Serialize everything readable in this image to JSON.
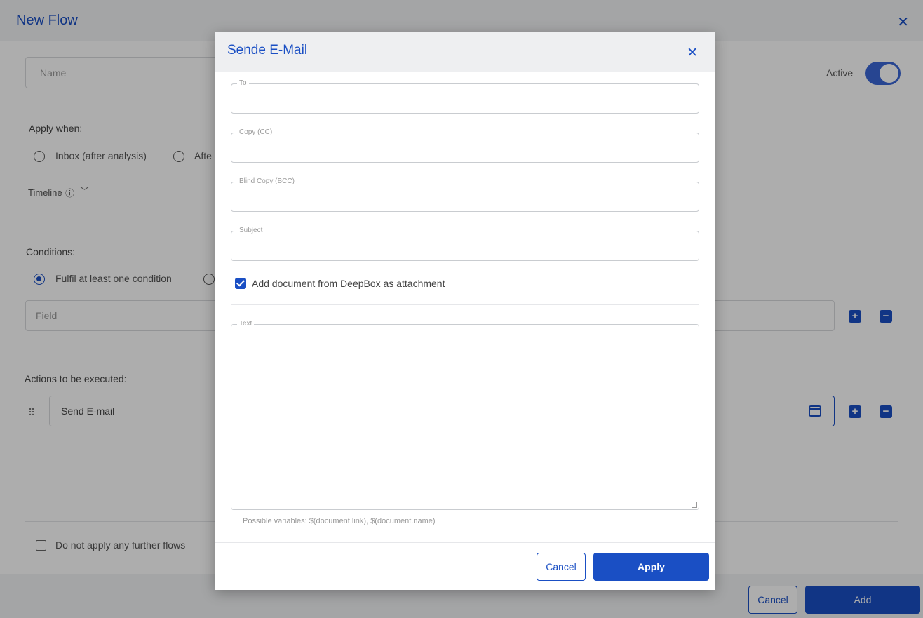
{
  "page": {
    "title": "New Flow",
    "close_icon": "✕",
    "name_placeholder": "Name",
    "active_label": "Active",
    "active_on": true,
    "apply_when_label": "Apply when:",
    "apply_when_options": [
      "Inbox (after analysis)",
      "Afte"
    ],
    "timeline_label": "Timeline",
    "timeline_info_icon": "ⓘ",
    "timeline_chevron": "﹀",
    "conditions_label": "Conditions:",
    "condition_option": "Fulfil at least one condition",
    "field_placeholder": "Field",
    "actions_label": "Actions to be executed:",
    "action_value": "Send E-mail",
    "drag_handle": "⠿",
    "plus": "+",
    "minus": "−",
    "no_further_flows_label": "Do not apply any further flows",
    "cancel_label": "Cancel",
    "add_label": "Add"
  },
  "modal": {
    "title": "Sende E-Mail",
    "close_icon": "✕",
    "fields": {
      "to": "To",
      "cc": "Copy (CC)",
      "bcc": "Blind Copy (BCC)",
      "subject": "Subject",
      "text": "Text"
    },
    "attachment_label": "Add document from DeepBox as attachment",
    "attachment_checked": true,
    "hint": "Possible variables: $(document.link), $(document.name)",
    "cancel_label": "Cancel",
    "apply_label": "Apply"
  },
  "colors": {
    "accent": "#1a4fc4",
    "toggle": "#3a66d6",
    "overlay": "rgba(0,0,0,0.32)"
  }
}
